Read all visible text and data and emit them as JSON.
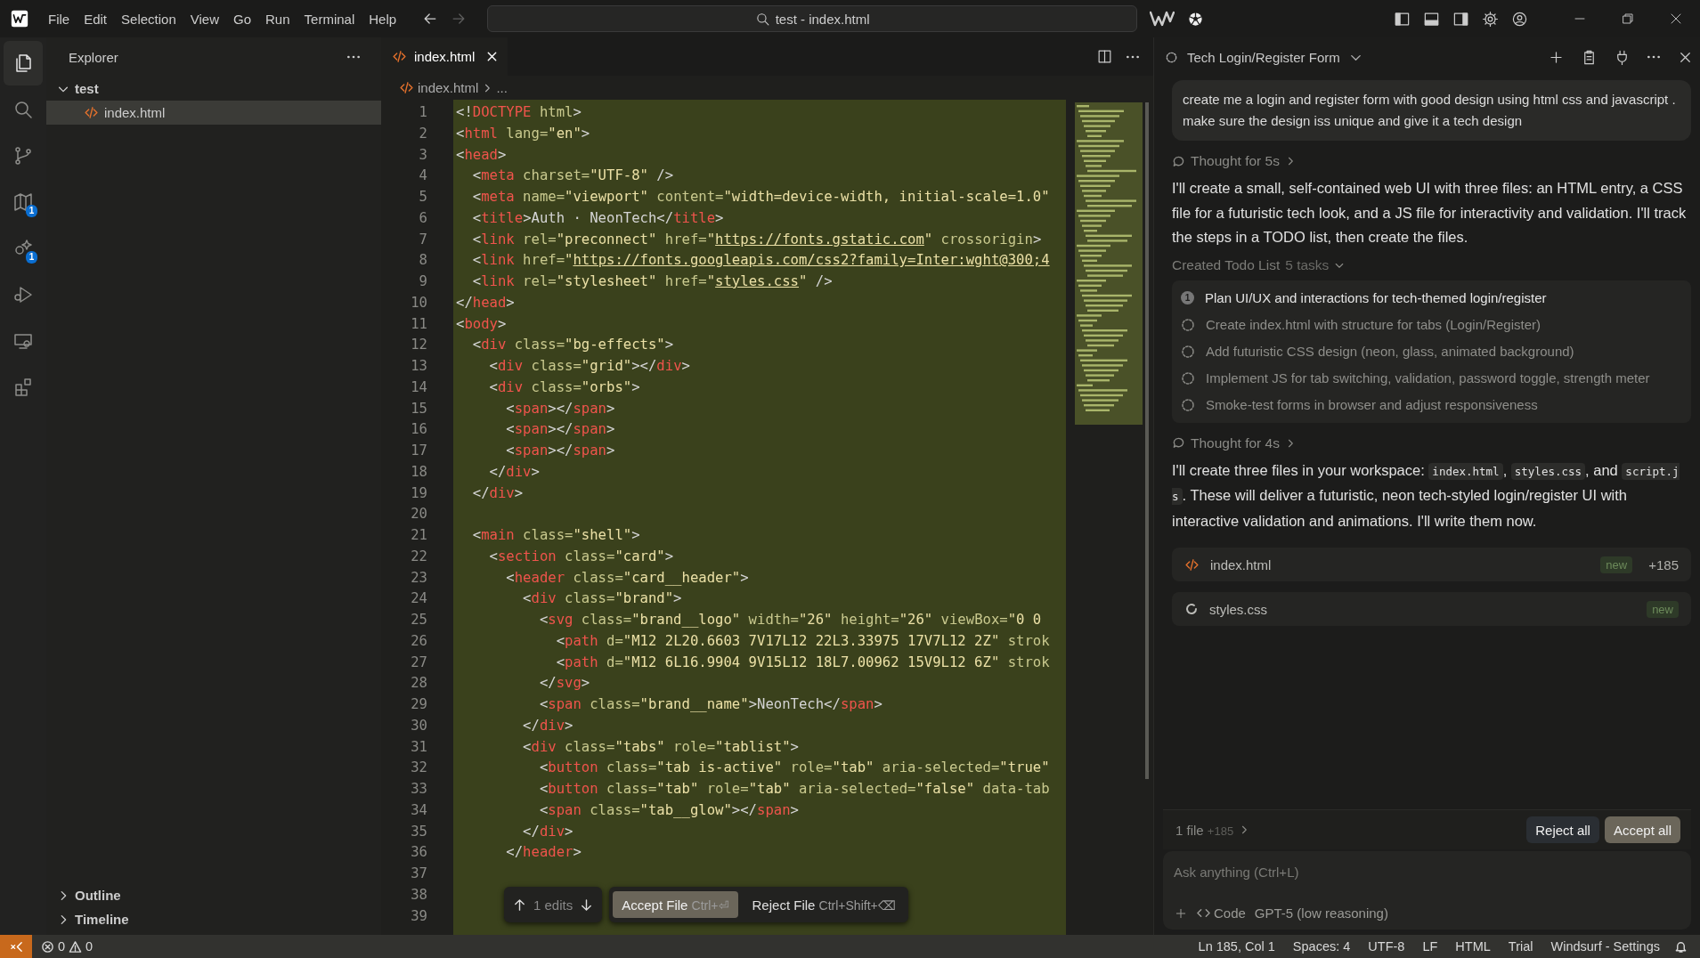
{
  "title_bar": {
    "menu": [
      "File",
      "Edit",
      "Selection",
      "View",
      "Go",
      "Run",
      "Terminal",
      "Help"
    ],
    "navigation": [
      {
        "disabled": false
      },
      {
        "disabled": true
      }
    ],
    "search": "test - index.html"
  },
  "activity_bar": {
    "items": [
      {
        "selected": true
      },
      {
        "selected": false
      },
      {
        "selected": false
      },
      {
        "selected": false,
        "badge": "1"
      },
      {
        "selected": false,
        "badge": "1"
      },
      {
        "selected": false
      },
      {
        "selected": false
      },
      {
        "selected": false
      }
    ]
  },
  "sidebar": {
    "title": "Explorer",
    "tree": [
      {
        "label": "test",
        "expanded": true,
        "children": [
          {
            "label": "index.html",
            "selected": true
          }
        ]
      }
    ],
    "sections": [
      {
        "label": "Outline",
        "expanded": false
      },
      {
        "label": "Timeline",
        "expanded": false
      }
    ]
  },
  "editor": {
    "tabs": [
      {
        "label": "index.html",
        "selected": true
      }
    ],
    "breadcrumb": [
      "index.html",
      "..."
    ],
    "lines": [
      {
        "number": "1",
        "tokens": [
          {
            "kind": "p",
            "text": "<!"
          },
          {
            "kind": "tag",
            "text": "DOCTYPE"
          },
          {
            "kind": "attr",
            "text": " html"
          },
          {
            "kind": "p",
            "text": ">"
          }
        ]
      },
      {
        "number": "2",
        "tokens": [
          {
            "kind": "p",
            "text": "<"
          },
          {
            "kind": "tag",
            "text": "html"
          },
          {
            "kind": "attr",
            "text": " lang="
          },
          {
            "kind": "str",
            "text": "\"en\""
          },
          {
            "kind": "p",
            "text": ">"
          }
        ]
      },
      {
        "number": "3",
        "tokens": [
          {
            "kind": "p",
            "text": "<"
          },
          {
            "kind": "tag",
            "text": "head"
          },
          {
            "kind": "p",
            "text": ">"
          }
        ]
      },
      {
        "number": "4",
        "tokens": [
          {
            "kind": "p",
            "text": "  <"
          },
          {
            "kind": "tag",
            "text": "meta"
          },
          {
            "kind": "attr",
            "text": " charset="
          },
          {
            "kind": "str",
            "text": "\"UTF-8\""
          },
          {
            "kind": "p",
            "text": " />"
          }
        ]
      },
      {
        "number": "5",
        "tokens": [
          {
            "kind": "p",
            "text": "  <"
          },
          {
            "kind": "tag",
            "text": "meta"
          },
          {
            "kind": "attr",
            "text": " name="
          },
          {
            "kind": "str",
            "text": "\"viewport\""
          },
          {
            "kind": "attr",
            "text": " content="
          },
          {
            "kind": "str",
            "text": "\"width=device-width, initial-scale=1.0\""
          }
        ]
      },
      {
        "number": "6",
        "tokens": [
          {
            "kind": "p",
            "text": "  <"
          },
          {
            "kind": "tag",
            "text": "title"
          },
          {
            "kind": "p",
            "text": ">Auth · NeonTech</"
          },
          {
            "kind": "tag",
            "text": "title"
          },
          {
            "kind": "p",
            "text": ">"
          }
        ]
      },
      {
        "number": "7",
        "tokens": [
          {
            "kind": "p",
            "text": "  <"
          },
          {
            "kind": "tag",
            "text": "link"
          },
          {
            "kind": "attr",
            "text": " rel="
          },
          {
            "kind": "str",
            "text": "\"preconnect\""
          },
          {
            "kind": "attr",
            "text": " href="
          },
          {
            "kind": "str",
            "text": "\""
          },
          {
            "kind": "link",
            "text": "https://fonts.gstatic.com"
          },
          {
            "kind": "str",
            "text": "\""
          },
          {
            "kind": "attr",
            "text": " crossorigin"
          },
          {
            "kind": "p",
            "text": ">"
          }
        ]
      },
      {
        "number": "8",
        "tokens": [
          {
            "kind": "p",
            "text": "  <"
          },
          {
            "kind": "tag",
            "text": "link"
          },
          {
            "kind": "attr",
            "text": " href="
          },
          {
            "kind": "str",
            "text": "\""
          },
          {
            "kind": "link",
            "text": "https://fonts.googleapis.com/css2?family=Inter:wght@300;4"
          }
        ]
      },
      {
        "number": "9",
        "tokens": [
          {
            "kind": "p",
            "text": "  <"
          },
          {
            "kind": "tag",
            "text": "link"
          },
          {
            "kind": "attr",
            "text": " rel="
          },
          {
            "kind": "str",
            "text": "\"stylesheet\""
          },
          {
            "kind": "attr",
            "text": " href="
          },
          {
            "kind": "str",
            "text": "\""
          },
          {
            "kind": "link",
            "text": "styles.css"
          },
          {
            "kind": "str",
            "text": "\""
          },
          {
            "kind": "p",
            "text": " />"
          }
        ]
      },
      {
        "number": "10",
        "tokens": [
          {
            "kind": "p",
            "text": "</"
          },
          {
            "kind": "tag",
            "text": "head"
          },
          {
            "kind": "p",
            "text": ">"
          }
        ]
      },
      {
        "number": "11",
        "tokens": [
          {
            "kind": "p",
            "text": "<"
          },
          {
            "kind": "tag",
            "text": "body"
          },
          {
            "kind": "p",
            "text": ">"
          }
        ]
      },
      {
        "number": "12",
        "tokens": [
          {
            "kind": "p",
            "text": "  <"
          },
          {
            "kind": "tag",
            "text": "div"
          },
          {
            "kind": "attr",
            "text": " class="
          },
          {
            "kind": "str",
            "text": "\"bg-effects\""
          },
          {
            "kind": "p",
            "text": ">"
          }
        ]
      },
      {
        "number": "13",
        "tokens": [
          {
            "kind": "p",
            "text": "    <"
          },
          {
            "kind": "tag",
            "text": "div"
          },
          {
            "kind": "attr",
            "text": " class="
          },
          {
            "kind": "str",
            "text": "\"grid\""
          },
          {
            "kind": "p",
            "text": "></"
          },
          {
            "kind": "tag",
            "text": "div"
          },
          {
            "kind": "p",
            "text": ">"
          }
        ]
      },
      {
        "number": "14",
        "tokens": [
          {
            "kind": "p",
            "text": "    <"
          },
          {
            "kind": "tag",
            "text": "div"
          },
          {
            "kind": "attr",
            "text": " class="
          },
          {
            "kind": "str",
            "text": "\"orbs\""
          },
          {
            "kind": "p",
            "text": ">"
          }
        ]
      },
      {
        "number": "15",
        "tokens": [
          {
            "kind": "p",
            "text": "      <"
          },
          {
            "kind": "tag",
            "text": "span"
          },
          {
            "kind": "p",
            "text": "></"
          },
          {
            "kind": "tag",
            "text": "span"
          },
          {
            "kind": "p",
            "text": ">"
          }
        ]
      },
      {
        "number": "16",
        "tokens": [
          {
            "kind": "p",
            "text": "      <"
          },
          {
            "kind": "tag",
            "text": "span"
          },
          {
            "kind": "p",
            "text": "></"
          },
          {
            "kind": "tag",
            "text": "span"
          },
          {
            "kind": "p",
            "text": ">"
          }
        ]
      },
      {
        "number": "17",
        "tokens": [
          {
            "kind": "p",
            "text": "      <"
          },
          {
            "kind": "tag",
            "text": "span"
          },
          {
            "kind": "p",
            "text": "></"
          },
          {
            "kind": "tag",
            "text": "span"
          },
          {
            "kind": "p",
            "text": ">"
          }
        ]
      },
      {
        "number": "18",
        "tokens": [
          {
            "kind": "p",
            "text": "    </"
          },
          {
            "kind": "tag",
            "text": "div"
          },
          {
            "kind": "p",
            "text": ">"
          }
        ]
      },
      {
        "number": "19",
        "tokens": [
          {
            "kind": "p",
            "text": "  </"
          },
          {
            "kind": "tag",
            "text": "div"
          },
          {
            "kind": "p",
            "text": ">"
          }
        ]
      },
      {
        "number": "20"
      },
      {
        "number": "21",
        "tokens": [
          {
            "kind": "p",
            "text": "  <"
          },
          {
            "kind": "tag",
            "text": "main"
          },
          {
            "kind": "attr",
            "text": " class="
          },
          {
            "kind": "str",
            "text": "\"shell\""
          },
          {
            "kind": "p",
            "text": ">"
          }
        ]
      },
      {
        "number": "22",
        "tokens": [
          {
            "kind": "p",
            "text": "    <"
          },
          {
            "kind": "tag",
            "text": "section"
          },
          {
            "kind": "attr",
            "text": " class="
          },
          {
            "kind": "str",
            "text": "\"card\""
          },
          {
            "kind": "p",
            "text": ">"
          }
        ]
      },
      {
        "number": "23",
        "tokens": [
          {
            "kind": "p",
            "text": "      <"
          },
          {
            "kind": "tag",
            "text": "header"
          },
          {
            "kind": "attr",
            "text": " class="
          },
          {
            "kind": "str",
            "text": "\"card__header\""
          },
          {
            "kind": "p",
            "text": ">"
          }
        ]
      },
      {
        "number": "24",
        "tokens": [
          {
            "kind": "p",
            "text": "        <"
          },
          {
            "kind": "tag",
            "text": "div"
          },
          {
            "kind": "attr",
            "text": " class="
          },
          {
            "kind": "str",
            "text": "\"brand\""
          },
          {
            "kind": "p",
            "text": ">"
          }
        ]
      },
      {
        "number": "25",
        "tokens": [
          {
            "kind": "p",
            "text": "          <"
          },
          {
            "kind": "tag",
            "text": "svg"
          },
          {
            "kind": "attr",
            "text": " class="
          },
          {
            "kind": "str",
            "text": "\"brand__logo\""
          },
          {
            "kind": "attr",
            "text": " width="
          },
          {
            "kind": "str",
            "text": "\"26\""
          },
          {
            "kind": "attr",
            "text": " height="
          },
          {
            "kind": "str",
            "text": "\"26\""
          },
          {
            "kind": "attr",
            "text": " viewBox="
          },
          {
            "kind": "str",
            "text": "\"0 0"
          }
        ]
      },
      {
        "number": "26",
        "tokens": [
          {
            "kind": "p",
            "text": "            <"
          },
          {
            "kind": "tag",
            "text": "path"
          },
          {
            "kind": "attr",
            "text": " d="
          },
          {
            "kind": "str",
            "text": "\"M12 2L20.6603 7V17L12 22L3.33975 17V7L12 2Z\""
          },
          {
            "kind": "attr",
            "text": " strok"
          }
        ]
      },
      {
        "number": "27",
        "tokens": [
          {
            "kind": "p",
            "text": "            <"
          },
          {
            "kind": "tag",
            "text": "path"
          },
          {
            "kind": "attr",
            "text": " d="
          },
          {
            "kind": "str",
            "text": "\"M12 6L16.9904 9V15L12 18L7.00962 15V9L12 6Z\""
          },
          {
            "kind": "attr",
            "text": " strok"
          }
        ]
      },
      {
        "number": "28",
        "tokens": [
          {
            "kind": "p",
            "text": "          </"
          },
          {
            "kind": "tag",
            "text": "svg"
          },
          {
            "kind": "p",
            "text": ">"
          }
        ]
      },
      {
        "number": "29",
        "tokens": [
          {
            "kind": "p",
            "text": "          <"
          },
          {
            "kind": "tag",
            "text": "span"
          },
          {
            "kind": "attr",
            "text": " class="
          },
          {
            "kind": "str",
            "text": "\"brand__name\""
          },
          {
            "kind": "p",
            "text": ">NeonTech</"
          },
          {
            "kind": "tag",
            "text": "span"
          },
          {
            "kind": "p",
            "text": ">"
          }
        ]
      },
      {
        "number": "30",
        "tokens": [
          {
            "kind": "p",
            "text": "        </"
          },
          {
            "kind": "tag",
            "text": "div"
          },
          {
            "kind": "p",
            "text": ">"
          }
        ]
      },
      {
        "number": "31",
        "tokens": [
          {
            "kind": "p",
            "text": "        <"
          },
          {
            "kind": "tag",
            "text": "div"
          },
          {
            "kind": "attr",
            "text": " class="
          },
          {
            "kind": "str",
            "text": "\"tabs\""
          },
          {
            "kind": "attr",
            "text": " role="
          },
          {
            "kind": "str",
            "text": "\"tablist\""
          },
          {
            "kind": "p",
            "text": ">"
          }
        ]
      },
      {
        "number": "32",
        "tokens": [
          {
            "kind": "p",
            "text": "          <"
          },
          {
            "kind": "tag",
            "text": "button"
          },
          {
            "kind": "attr",
            "text": " class="
          },
          {
            "kind": "str",
            "text": "\"tab is-active\""
          },
          {
            "kind": "attr",
            "text": " role="
          },
          {
            "kind": "str",
            "text": "\"tab\""
          },
          {
            "kind": "attr",
            "text": " aria-selected="
          },
          {
            "kind": "str",
            "text": "\"true\""
          }
        ]
      },
      {
        "number": "33",
        "tokens": [
          {
            "kind": "p",
            "text": "          <"
          },
          {
            "kind": "tag",
            "text": "button"
          },
          {
            "kind": "attr",
            "text": " class="
          },
          {
            "kind": "str",
            "text": "\"tab\""
          },
          {
            "kind": "attr",
            "text": " role="
          },
          {
            "kind": "str",
            "text": "\"tab\""
          },
          {
            "kind": "attr",
            "text": " aria-selected="
          },
          {
            "kind": "str",
            "text": "\"false\""
          },
          {
            "kind": "attr",
            "text": " data-tab"
          }
        ]
      },
      {
        "number": "34",
        "tokens": [
          {
            "kind": "p",
            "text": "          <"
          },
          {
            "kind": "tag",
            "text": "span"
          },
          {
            "kind": "attr",
            "text": " class="
          },
          {
            "kind": "str",
            "text": "\"tab__glow\""
          },
          {
            "kind": "p",
            "text": "></"
          },
          {
            "kind": "tag",
            "text": "span"
          },
          {
            "kind": "p",
            "text": ">"
          }
        ]
      },
      {
        "number": "35",
        "tokens": [
          {
            "kind": "p",
            "text": "        </"
          },
          {
            "kind": "tag",
            "text": "div"
          },
          {
            "kind": "p",
            "text": ">"
          }
        ]
      },
      {
        "number": "36",
        "tokens": [
          {
            "kind": "p",
            "text": "      </"
          },
          {
            "kind": "tag",
            "text": "header"
          },
          {
            "kind": "p",
            "text": ">"
          }
        ]
      },
      {
        "number": "37"
      },
      {
        "number": "38"
      },
      {
        "number": "39"
      }
    ],
    "edit_bar": {
      "count": "1 edits",
      "accept": {
        "label": "Accept File",
        "shortcut": "Ctrl+⏎"
      },
      "reject": {
        "label": "Reject File",
        "shortcut": "Ctrl+Shift+⌫"
      }
    }
  },
  "chat": {
    "title": "Tech Login/Register Form",
    "blocks": [
      {
        "kind": "user",
        "text": "create me a login and register form with good design using html css and javascript . make sure the design iss unique and give it a tech design"
      },
      {
        "kind": "thought",
        "text": "Thought for 5s"
      },
      {
        "kind": "paragraph",
        "parts": [
          {
            "text": "I'll create a small, self-contained web UI with three files: an HTML entry, a CSS file for a futuristic tech look, and a JS file for interactivity and validation. I'll track the steps in a TODO list, then create the files."
          }
        ]
      },
      {
        "kind": "todo",
        "heading": "Created Todo List",
        "count": "5 tasks",
        "items": [
          {
            "active": true,
            "number": "1",
            "text": "Plan UI/UX and interactions for tech-themed login/register"
          },
          {
            "active": false,
            "text": "Create index.html with structure for tabs (Login/Register)"
          },
          {
            "active": false,
            "text": "Add futuristic CSS design (neon, glass, animated background)"
          },
          {
            "active": false,
            "text": "Implement JS for tab switching, validation, password toggle, strength meter"
          },
          {
            "active": false,
            "text": "Smoke-test forms in browser and adjust responsiveness"
          }
        ]
      },
      {
        "kind": "thought",
        "text": "Thought for 4s"
      },
      {
        "kind": "paragraph",
        "parts": [
          {
            "text": "I'll create three files in your workspace: "
          },
          {
            "code": "index.html"
          },
          {
            "text": ", "
          },
          {
            "code": "styles.css"
          },
          {
            "text": ", and "
          },
          {
            "code": "script.js"
          },
          {
            "text": ". These will deliver a futuristic, neon tech-styled login/register UI with interactive validation and animations. I'll write them now."
          }
        ]
      },
      {
        "kind": "file",
        "name": "index.html",
        "loading": false,
        "badge": "new",
        "added": "+185"
      },
      {
        "kind": "file",
        "name": "styles.css",
        "loading": true,
        "badge": "new"
      }
    ],
    "changes": {
      "count": "1 file",
      "added": "+185"
    },
    "buttons": [
      "Reject all",
      "Accept all"
    ],
    "input": {
      "placeholder": "Ask anything (Ctrl+L)"
    },
    "mode": "Code",
    "model": "GPT-5 (low reasoning)"
  },
  "status_bar": {
    "errors": "0",
    "warnings": "0",
    "items": [
      "Ln 185, Col 1",
      "Spaces: 4",
      "UTF-8",
      "LF",
      "HTML",
      "Trial",
      "Windsurf - Settings"
    ]
  }
}
